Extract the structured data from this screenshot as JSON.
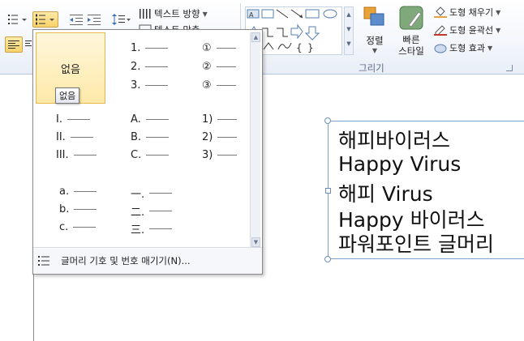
{
  "ribbon": {
    "text_direction_label": "텍스트 방향",
    "align_text_label": "텍스트 맞춤",
    "arrange_label": "정렬",
    "quick_styles_label": "빠른 스타일",
    "shape_fill_label": "도형 채우기",
    "shape_outline_label": "도형 윤곽선",
    "shape_effects_label": "도형 효과",
    "drawing_group_label": "그리기"
  },
  "numbering_menu": {
    "none_label": "없음",
    "tooltip": "없음",
    "col1_row1": [
      "1.",
      "2.",
      "3."
    ],
    "col2_row1": [
      "①",
      "②",
      "③"
    ],
    "col0_row2": [
      "I.",
      "II.",
      "III."
    ],
    "col1_row2": [
      "A.",
      "B.",
      "C."
    ],
    "col2_row2": [
      "1)",
      "2)",
      "3)"
    ],
    "col0_row3": [
      "a.",
      "b.",
      "c."
    ],
    "col1_row3": [
      "一.",
      "二.",
      "三."
    ],
    "footer_label": "글머리 기호 및 번호 매기기(N)..."
  },
  "textbox": {
    "lines": [
      "해피바이러스",
      "Happy Virus",
      "해피 Virus",
      "Happy 바이러스",
      "파워포인트 글머리"
    ]
  }
}
